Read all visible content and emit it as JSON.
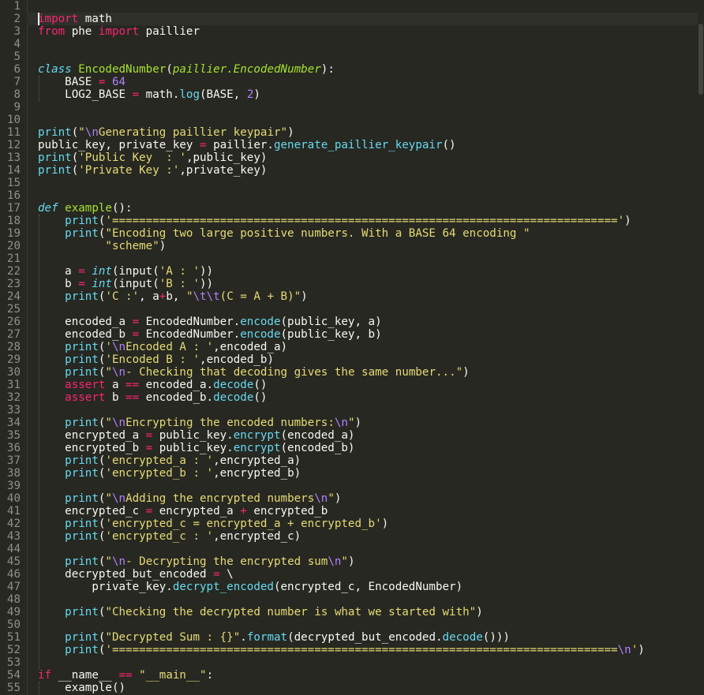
{
  "editor": {
    "colors": {
      "background": "#272822",
      "text": "#f8f8f2",
      "keyword": "#f92672",
      "string": "#e6db74",
      "number": "#ae81ff",
      "function": "#66d9ef",
      "class_name": "#a6e22e",
      "line_number": "#8f908a"
    },
    "cursor_line": 2,
    "lines": [
      [],
      [
        [
          "k",
          "import"
        ],
        [
          "t",
          " math"
        ]
      ],
      [
        [
          "k",
          "from"
        ],
        [
          "t",
          " phe "
        ],
        [
          "k",
          "import"
        ],
        [
          "t",
          " paillier"
        ]
      ],
      [],
      [],
      [
        [
          "it",
          "class"
        ],
        [
          "t",
          " "
        ],
        [
          "cls",
          "EncodedNumber"
        ],
        [
          "t",
          "("
        ],
        [
          "inh",
          "paillier.EncodedNumber"
        ],
        [
          "t",
          "):"
        ]
      ],
      [
        [
          "t",
          "    BASE "
        ],
        [
          "k",
          "="
        ],
        [
          "t",
          " "
        ],
        [
          "n",
          "64"
        ]
      ],
      [
        [
          "t",
          "    LOG2_BASE "
        ],
        [
          "k",
          "="
        ],
        [
          "t",
          " math."
        ],
        [
          "f",
          "log"
        ],
        [
          "t",
          "(BASE, "
        ],
        [
          "n",
          "2"
        ],
        [
          "t",
          ")"
        ]
      ],
      [],
      [],
      [
        [
          "f",
          "print"
        ],
        [
          "t",
          "("
        ],
        [
          "s",
          "\""
        ],
        [
          "n",
          "\\n"
        ],
        [
          "s",
          "Generating paillier keypair\""
        ],
        [
          "t",
          ")"
        ]
      ],
      [
        [
          "t",
          "public_key, private_key "
        ],
        [
          "k",
          "="
        ],
        [
          "t",
          " paillier."
        ],
        [
          "f",
          "generate_paillier_keypair"
        ],
        [
          "t",
          "()"
        ]
      ],
      [
        [
          "f",
          "print"
        ],
        [
          "t",
          "("
        ],
        [
          "s",
          "'Public Key  : '"
        ],
        [
          "t",
          ",public_key)"
        ]
      ],
      [
        [
          "f",
          "print"
        ],
        [
          "t",
          "("
        ],
        [
          "s",
          "'Private Key :'"
        ],
        [
          "t",
          ",private_key)"
        ]
      ],
      [],
      [],
      [
        [
          "it",
          "def"
        ],
        [
          "t",
          " "
        ],
        [
          "cls",
          "example"
        ],
        [
          "t",
          "():"
        ]
      ],
      [
        [
          "t",
          "    "
        ],
        [
          "f",
          "print"
        ],
        [
          "t",
          "("
        ],
        [
          "s",
          "'==========================================================================='"
        ],
        [
          "t",
          ")"
        ]
      ],
      [
        [
          "t",
          "    "
        ],
        [
          "f",
          "print"
        ],
        [
          "t",
          "("
        ],
        [
          "s",
          "\"Encoding two large positive numbers. With a BASE 64 encoding \""
        ]
      ],
      [
        [
          "t",
          "          "
        ],
        [
          "s",
          "\"scheme\""
        ],
        [
          "t",
          ")"
        ]
      ],
      [],
      [
        [
          "t",
          "    a "
        ],
        [
          "k",
          "="
        ],
        [
          "t",
          " "
        ],
        [
          "it",
          "int"
        ],
        [
          "t",
          "(input("
        ],
        [
          "s",
          "'A : '"
        ],
        [
          "t",
          "))"
        ]
      ],
      [
        [
          "t",
          "    b "
        ],
        [
          "k",
          "="
        ],
        [
          "t",
          " "
        ],
        [
          "it",
          "int"
        ],
        [
          "t",
          "(input("
        ],
        [
          "s",
          "'B : '"
        ],
        [
          "t",
          "))"
        ]
      ],
      [
        [
          "t",
          "    "
        ],
        [
          "f",
          "print"
        ],
        [
          "t",
          "("
        ],
        [
          "s",
          "'C :'"
        ],
        [
          "t",
          ", a"
        ],
        [
          "k",
          "+"
        ],
        [
          "t",
          "b, "
        ],
        [
          "s",
          "\""
        ],
        [
          "n",
          "\\t\\t"
        ],
        [
          "s",
          "(C = A + B)\""
        ],
        [
          "t",
          ")"
        ]
      ],
      [],
      [
        [
          "t",
          "    encoded_a "
        ],
        [
          "k",
          "="
        ],
        [
          "t",
          " EncodedNumber."
        ],
        [
          "f",
          "encode"
        ],
        [
          "t",
          "(public_key, a)"
        ]
      ],
      [
        [
          "t",
          "    encoded_b "
        ],
        [
          "k",
          "="
        ],
        [
          "t",
          " EncodedNumber."
        ],
        [
          "f",
          "encode"
        ],
        [
          "t",
          "(public_key, b)"
        ]
      ],
      [
        [
          "t",
          "    "
        ],
        [
          "f",
          "print"
        ],
        [
          "t",
          "("
        ],
        [
          "s",
          "'"
        ],
        [
          "n",
          "\\n"
        ],
        [
          "s",
          "Encoded A : '"
        ],
        [
          "t",
          ",encoded_a)"
        ]
      ],
      [
        [
          "t",
          "    "
        ],
        [
          "f",
          "print"
        ],
        [
          "t",
          "("
        ],
        [
          "s",
          "'Encoded B : '"
        ],
        [
          "t",
          ",encoded_b)"
        ]
      ],
      [
        [
          "t",
          "    "
        ],
        [
          "f",
          "print"
        ],
        [
          "t",
          "("
        ],
        [
          "s",
          "\""
        ],
        [
          "n",
          "\\n"
        ],
        [
          "s",
          "- Checking that decoding gives the same number...\""
        ],
        [
          "t",
          ")"
        ]
      ],
      [
        [
          "t",
          "    "
        ],
        [
          "k",
          "assert"
        ],
        [
          "t",
          " a "
        ],
        [
          "k",
          "=="
        ],
        [
          "t",
          " encoded_a."
        ],
        [
          "f",
          "decode"
        ],
        [
          "t",
          "()"
        ]
      ],
      [
        [
          "t",
          "    "
        ],
        [
          "k",
          "assert"
        ],
        [
          "t",
          " b "
        ],
        [
          "k",
          "=="
        ],
        [
          "t",
          " encoded_b."
        ],
        [
          "f",
          "decode"
        ],
        [
          "t",
          "()"
        ]
      ],
      [],
      [
        [
          "t",
          "    "
        ],
        [
          "f",
          "print"
        ],
        [
          "t",
          "("
        ],
        [
          "s",
          "\""
        ],
        [
          "n",
          "\\n"
        ],
        [
          "s",
          "Encrypting the encoded numbers:"
        ],
        [
          "n",
          "\\n"
        ],
        [
          "s",
          "\""
        ],
        [
          "t",
          ")"
        ]
      ],
      [
        [
          "t",
          "    encrypted_a "
        ],
        [
          "k",
          "="
        ],
        [
          "t",
          " public_key."
        ],
        [
          "f",
          "encrypt"
        ],
        [
          "t",
          "(encoded_a)"
        ]
      ],
      [
        [
          "t",
          "    encrypted_b "
        ],
        [
          "k",
          "="
        ],
        [
          "t",
          " public_key."
        ],
        [
          "f",
          "encrypt"
        ],
        [
          "t",
          "(encoded_b)"
        ]
      ],
      [
        [
          "t",
          "    "
        ],
        [
          "f",
          "print"
        ],
        [
          "t",
          "("
        ],
        [
          "s",
          "'encrypted_a : '"
        ],
        [
          "t",
          ",encrypted_a)"
        ]
      ],
      [
        [
          "t",
          "    "
        ],
        [
          "f",
          "print"
        ],
        [
          "t",
          "("
        ],
        [
          "s",
          "'encrypted_b : '"
        ],
        [
          "t",
          ",encrypted_b)"
        ]
      ],
      [],
      [
        [
          "t",
          "    "
        ],
        [
          "f",
          "print"
        ],
        [
          "t",
          "("
        ],
        [
          "s",
          "\""
        ],
        [
          "n",
          "\\n"
        ],
        [
          "s",
          "Adding the encrypted numbers"
        ],
        [
          "n",
          "\\n"
        ],
        [
          "s",
          "\""
        ],
        [
          "t",
          ")"
        ]
      ],
      [
        [
          "t",
          "    encrypted_c "
        ],
        [
          "k",
          "="
        ],
        [
          "t",
          " encrypted_a "
        ],
        [
          "k",
          "+"
        ],
        [
          "t",
          " encrypted_b"
        ]
      ],
      [
        [
          "t",
          "    "
        ],
        [
          "f",
          "print"
        ],
        [
          "t",
          "("
        ],
        [
          "s",
          "'encrypted_c = encrypted_a + encrypted_b'"
        ],
        [
          "t",
          ")"
        ]
      ],
      [
        [
          "t",
          "    "
        ],
        [
          "f",
          "print"
        ],
        [
          "t",
          "("
        ],
        [
          "s",
          "'encrypted_c : '"
        ],
        [
          "t",
          ",encrypted_c)"
        ]
      ],
      [],
      [
        [
          "t",
          "    "
        ],
        [
          "f",
          "print"
        ],
        [
          "t",
          "("
        ],
        [
          "s",
          "\""
        ],
        [
          "n",
          "\\n"
        ],
        [
          "s",
          "- Decrypting the encrypted sum"
        ],
        [
          "n",
          "\\n"
        ],
        [
          "s",
          "\""
        ],
        [
          "t",
          ")"
        ]
      ],
      [
        [
          "t",
          "    decrypted_but_encoded "
        ],
        [
          "k",
          "="
        ],
        [
          "t",
          " \\"
        ]
      ],
      [
        [
          "t",
          "        private_key."
        ],
        [
          "f",
          "decrypt_encoded"
        ],
        [
          "t",
          "(encrypted_c, EncodedNumber)"
        ]
      ],
      [],
      [
        [
          "t",
          "    "
        ],
        [
          "f",
          "print"
        ],
        [
          "t",
          "("
        ],
        [
          "s",
          "\"Checking the decrypted number is what we started with\""
        ],
        [
          "t",
          ")"
        ]
      ],
      [],
      [
        [
          "t",
          "    "
        ],
        [
          "f",
          "print"
        ],
        [
          "t",
          "("
        ],
        [
          "s",
          "\"Decrypted Sum : {}\""
        ],
        [
          "t",
          "."
        ],
        [
          "f",
          "format"
        ],
        [
          "t",
          "(decrypted_but_encoded."
        ],
        [
          "f",
          "decode"
        ],
        [
          "t",
          "()))"
        ]
      ],
      [
        [
          "t",
          "    "
        ],
        [
          "f",
          "print"
        ],
        [
          "t",
          "("
        ],
        [
          "s",
          "'==========================================================================="
        ],
        [
          "n",
          "\\n"
        ],
        [
          "s",
          "'"
        ],
        [
          "t",
          ")"
        ]
      ],
      [],
      [
        [
          "k",
          "if"
        ],
        [
          "t",
          " __name__ "
        ],
        [
          "k",
          "=="
        ],
        [
          "t",
          " "
        ],
        [
          "s",
          "\"__main__\""
        ],
        [
          "t",
          ":"
        ]
      ],
      [
        [
          "t",
          "    example()"
        ]
      ]
    ]
  }
}
